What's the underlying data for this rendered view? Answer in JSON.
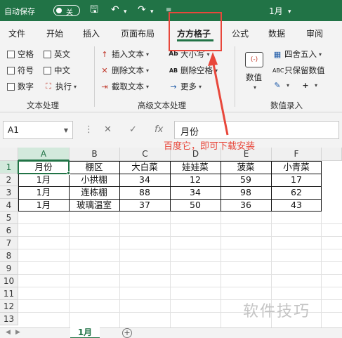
{
  "titlebar": {
    "autosave_label": "自动保存",
    "autosave_state": "关",
    "workbook_name": "1月"
  },
  "tabs": [
    "文件",
    "开始",
    "插入",
    "页面布局",
    "方方格子",
    "公式",
    "数据",
    "审阅"
  ],
  "active_tab": "方方格子",
  "ribbon": {
    "text_group": {
      "label": "文本处理",
      "checkboxes": [
        "空格",
        "英文",
        "符号",
        "中文",
        "数字"
      ],
      "execute": "执行"
    },
    "advanced_group": {
      "label": "高级文本处理",
      "insert_text": "插入文本",
      "delete_text": "删除文本",
      "extract_text": "截取文本",
      "case": "大小写",
      "delete_space": "删除空格",
      "more": "更多"
    },
    "numeric_group": {
      "label": "数值录入",
      "value": "数值",
      "round": "四舍五入",
      "keep_values": "只保留数值",
      "value_icon_text": "(-)"
    }
  },
  "formula_bar": {
    "name_box": "A1",
    "formula": "月份"
  },
  "annotation": "百度它，即可下载安装",
  "grid": {
    "columns": [
      "A",
      "B",
      "C",
      "D",
      "E",
      "F"
    ],
    "rows": [
      "1",
      "2",
      "3",
      "4",
      "5",
      "6",
      "7",
      "8",
      "9",
      "10",
      "11",
      "12",
      "13"
    ],
    "headers": [
      "月份",
      "棚区",
      "大白菜",
      "娃娃菜",
      "菠菜",
      "小青菜"
    ],
    "data": [
      [
        "1月",
        "小拱棚",
        "34",
        "12",
        "59",
        "17"
      ],
      [
        "1月",
        "连栋棚",
        "88",
        "34",
        "98",
        "62"
      ],
      [
        "1月",
        "玻璃温室",
        "37",
        "50",
        "36",
        "43"
      ]
    ]
  },
  "sheet_tab": "1月",
  "watermark": "软件技巧",
  "colors": {
    "excel_green": "#217346",
    "annotation_red": "#e8473b"
  }
}
